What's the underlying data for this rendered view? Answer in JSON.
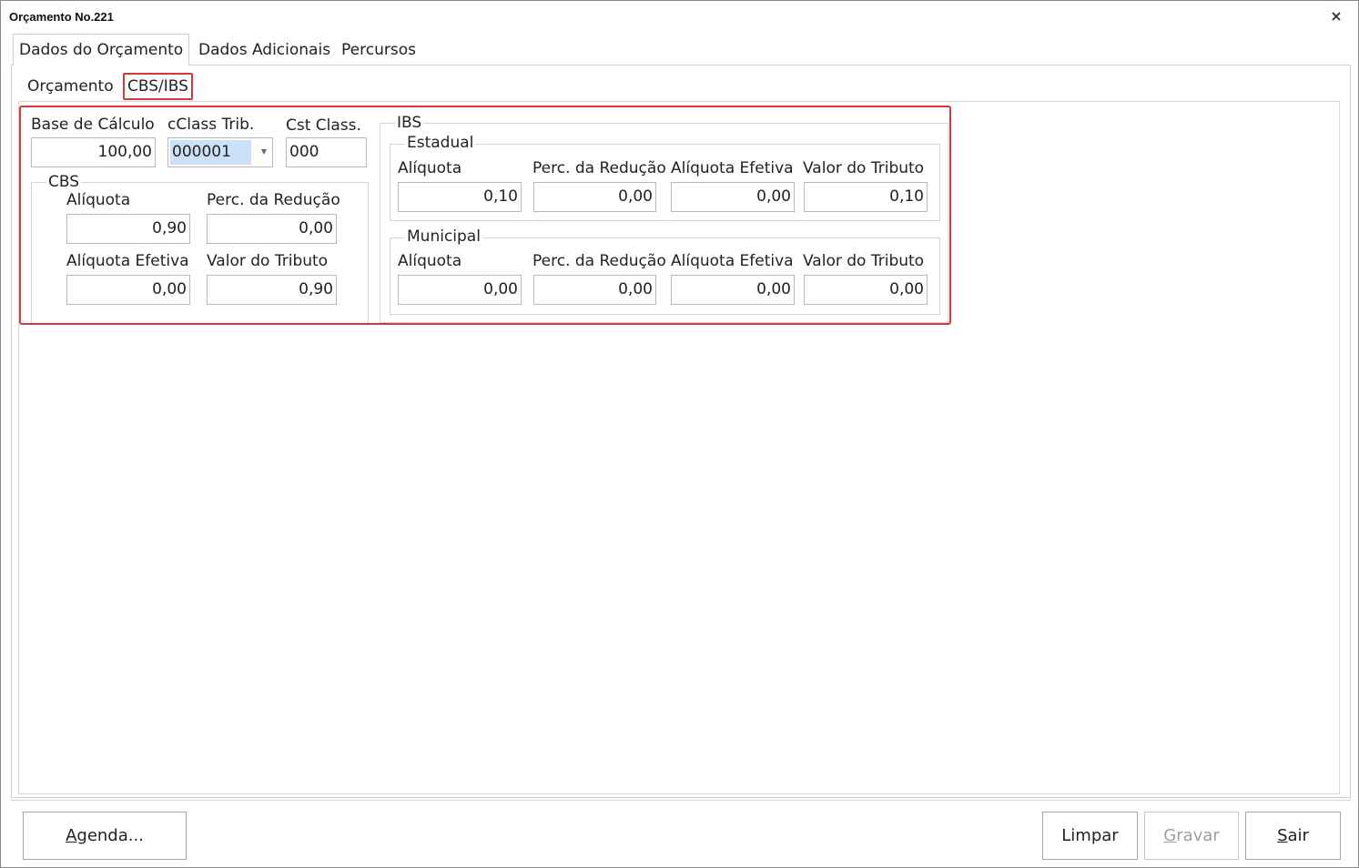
{
  "window": {
    "title": "Orçamento No.221",
    "close_glyph": "×"
  },
  "tabs": [
    {
      "label": "Dados do Orçamento",
      "active": true
    },
    {
      "label": "Dados Adicionais",
      "active": false
    },
    {
      "label": "Percursos",
      "active": false
    }
  ],
  "subtabs": [
    {
      "label": "Orçamento",
      "active": false
    },
    {
      "label": "CBS/IBS",
      "active": true
    }
  ],
  "form": {
    "base_calculo": {
      "label": "Base de Cálculo",
      "value": "100,00"
    },
    "cclass_trib": {
      "label": "cClass Trib.",
      "value": "000001"
    },
    "cst_class": {
      "label": "Cst Class.",
      "value": "000"
    }
  },
  "cbs": {
    "title": "CBS",
    "aliquota": {
      "label": "Alíquota",
      "value": "0,90"
    },
    "perc_reducao": {
      "label": "Perc. da Redução",
      "value": "0,00"
    },
    "aliquota_efetiva": {
      "label": "Alíquota Efetiva",
      "value": "0,00"
    },
    "valor_tributo": {
      "label": "Valor do Tributo",
      "value": "0,90"
    }
  },
  "ibs": {
    "title": "IBS",
    "estadual": {
      "title": "Estadual",
      "aliquota": {
        "label": "Alíquota",
        "value": "0,10"
      },
      "perc_reducao": {
        "label": "Perc. da Redução",
        "value": "0,00"
      },
      "aliquota_efetiva": {
        "label": "Alíquota Efetiva",
        "value": "0,00"
      },
      "valor_tributo": {
        "label": "Valor do Tributo",
        "value": "0,10"
      }
    },
    "municipal": {
      "title": "Municipal",
      "aliquota": {
        "label": "Alíquota",
        "value": "0,00"
      },
      "perc_reducao": {
        "label": "Perc. da Redução",
        "value": "0,00"
      },
      "aliquota_efetiva": {
        "label": "Alíquota Efetiva",
        "value": "0,00"
      },
      "valor_tributo": {
        "label": "Valor do Tributo",
        "value": "0,00"
      }
    }
  },
  "buttons": {
    "agenda": {
      "mnemonic": "A",
      "rest": "genda..."
    },
    "limpar": {
      "label": "Limpar"
    },
    "gravar": {
      "mnemonic": "G",
      "rest": "ravar",
      "disabled": true
    },
    "sair": {
      "mnemonic": "S",
      "rest": "air"
    }
  },
  "colors": {
    "highlight": "#d23a3a",
    "selection": "#cce0f7",
    "disabled_text": "#a0a0a0"
  }
}
